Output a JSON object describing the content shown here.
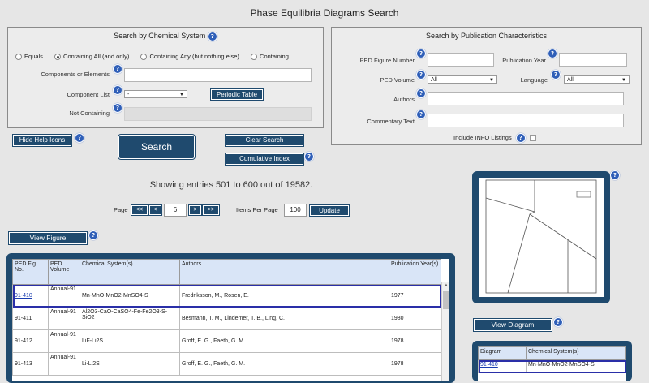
{
  "page_title": "Phase Equilibria Diagrams Search",
  "chem_panel": {
    "title": "Search by Chemical System",
    "radios": [
      {
        "label": "Equals",
        "selected": false
      },
      {
        "label": "Containing All (and only)",
        "selected": true
      },
      {
        "label": "Containing Any (but nothing else)",
        "selected": false
      },
      {
        "label": "Containing",
        "selected": false
      }
    ],
    "components_label": "Components or Elements",
    "component_list_label": "Component List",
    "component_list_value": "-",
    "periodic_table_label": "Periodic Table",
    "not_containing_label": "Not Containing"
  },
  "pub_panel": {
    "title": "Search by Publication Characteristics",
    "figure_number_label": "PED Figure Number",
    "publication_year_label": "Publication Year",
    "volume_label": "PED Volume",
    "volume_value": "All",
    "language_label": "Language",
    "language_value": "All",
    "authors_label": "Authors",
    "commentary_label": "Commentary Text",
    "include_info_label": "Include INFO Listings"
  },
  "buttons": {
    "hide_help": "Hide Help Icons",
    "search": "Search",
    "clear_search": "Clear Search",
    "cumulative_index": "Cumulative Index",
    "view_figure": "View Figure",
    "view_diagram": "View Diagram",
    "update": "Update"
  },
  "help_glyph": "?",
  "entries_text": "Showing entries 501 to 600 out of 19582.",
  "pagination": {
    "page_label": "Page",
    "first": "<<",
    "prev": "<",
    "current_page": "6",
    "next": ">",
    "last": ">>",
    "items_per_page_label": "Items Per Page",
    "items_per_page": "100"
  },
  "results_table": {
    "headers": [
      "PED Fig. No.",
      "PED Volume",
      "Chemical System(s)",
      "Authors",
      "Publication Year(s)"
    ],
    "rows": [
      {
        "fig": "91-410",
        "volume": "Annual-91",
        "system": "Mn-MnO-MnO2-MnSO4-S",
        "authors": "Fredriksson, M., Rosen, E.",
        "year": "1977"
      },
      {
        "fig": "91-411",
        "volume": "Annual-91",
        "system": "Al2O3-CaO-CaSO4-Fe-Fe2O3-S-SiO2",
        "authors": "Besmann, T. M., Lindemer, T. B., Ling, C.",
        "year": "1980"
      },
      {
        "fig": "91-412",
        "volume": "Annual-91",
        "system": "LiF-Li2S",
        "authors": "Groff, E. G., Faeth, G. M.",
        "year": "1978"
      },
      {
        "fig": "91-413",
        "volume": "Annual-91",
        "system": "Li-Li2S",
        "authors": "Groff, E. G., Faeth, G. M.",
        "year": "1978"
      }
    ]
  },
  "diagram_table": {
    "headers": [
      "Diagram",
      "Chemical System(s)"
    ],
    "rows": [
      {
        "diagram": "91-410",
        "system": "Mn-MnO-MnO2-MnSO4-S"
      }
    ]
  }
}
